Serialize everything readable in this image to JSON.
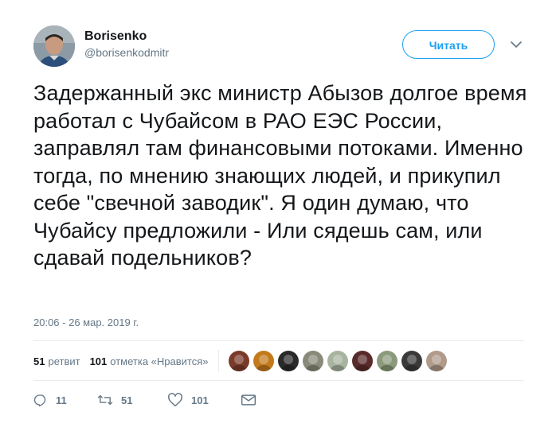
{
  "author": {
    "name": "Borisenko",
    "handle": "@borisenkodmitr"
  },
  "follow_button": {
    "label": "Читать"
  },
  "tweet": {
    "text": "Задержанный экс министр Абызов долгое время работал с Чубайсом в РАО ЕЭС России, заправлял там финансовыми потоками. Именно тогда, по мнению знающих людей, и прикупил себе \"свечной заводик\". Я один думаю, что Чубайсу предложили - Или сядешь сам, или сдавай подельников?",
    "timestamp": "20:06 - 26 мар. 2019 г."
  },
  "stats": {
    "retweets_count": "51",
    "retweets_label": "ретвит",
    "likes_count": "101",
    "likes_label": "отметка «Нравится»"
  },
  "likers": [
    {
      "color": "#7a3b2a"
    },
    {
      "color": "#c47a1c"
    },
    {
      "color": "#2a2a2a"
    },
    {
      "color": "#8a8a7a"
    },
    {
      "color": "#a8b4a0"
    },
    {
      "color": "#5a2b2b"
    },
    {
      "color": "#8a9a7a"
    },
    {
      "color": "#3a3a3a"
    },
    {
      "color": "#b09a8a"
    }
  ],
  "actions": {
    "reply_count": "11",
    "retweet_count": "51",
    "like_count": "101"
  },
  "colors": {
    "accent": "#1da1f2",
    "text": "#14171a",
    "secondary": "#657786",
    "divider": "#e6ecf0"
  },
  "icons": [
    "reply-icon",
    "retweet-icon",
    "heart-icon",
    "message-icon",
    "chevron-down-icon"
  ]
}
